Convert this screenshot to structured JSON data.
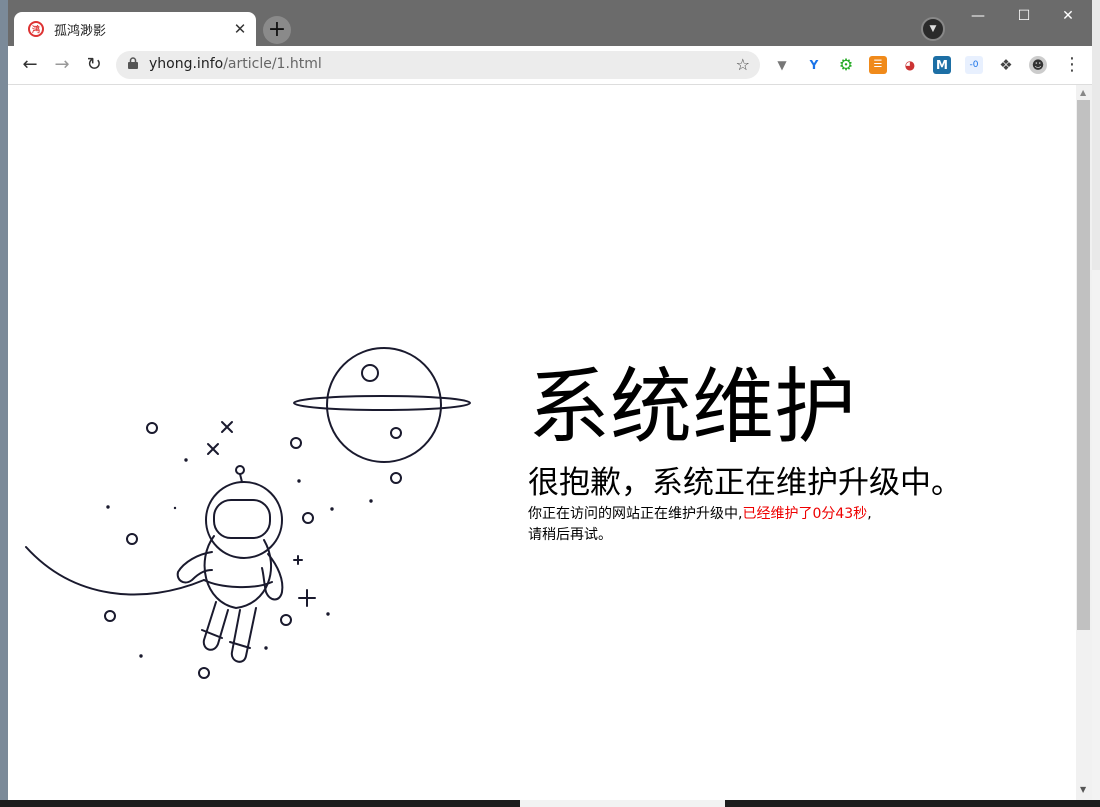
{
  "browser": {
    "tab_title": "孤鸿渺影",
    "tab_close": "✕",
    "new_tab": "+",
    "url_host": "yhong.info",
    "url_path": "/article/1.html"
  },
  "page": {
    "heading": "系统维护",
    "subheading": "很抱歉，系统正在维护升级中。",
    "desc_prefix": "你正在访问的网站正在维护升级中,",
    "desc_timer": "已经维护了0分43秒",
    "desc_suffix": ",",
    "desc_line2": "请稍后再试。"
  },
  "colors": {
    "titlebar": "#6b6b6b",
    "timer_text": "#e00000",
    "illustration_stroke": "#1a1a2e"
  }
}
